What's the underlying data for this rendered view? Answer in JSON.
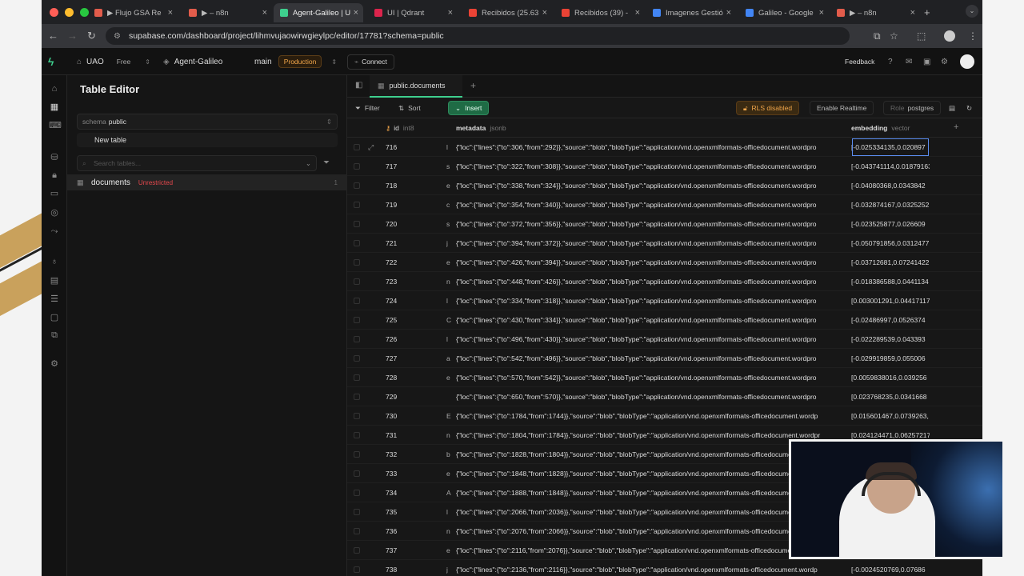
{
  "browser": {
    "tabs": [
      {
        "label": "▶ Flujo GSA Re",
        "color": "#e25c4b"
      },
      {
        "label": "▶ – n8n",
        "color": "#e25c4b"
      },
      {
        "label": "Agent-Galileo | U",
        "color": "#3ecf8e"
      },
      {
        "label": "UI | Qdrant",
        "color": "#dc244c"
      },
      {
        "label": "Recibidos (25.63",
        "color": "#ea4335"
      },
      {
        "label": "Recibidos (39) -",
        "color": "#ea4335"
      },
      {
        "label": "Imagenes Gestió",
        "color": "#4285f4"
      },
      {
        "label": "Galileo - Google",
        "color": "#4285f4"
      },
      {
        "label": "▶ – n8n",
        "color": "#e25c4b"
      }
    ],
    "url": "supabase.com/dashboard/project/lihmvujaowirwgieylpc/editor/17781?schema=public"
  },
  "topnav": {
    "org": "UAO",
    "plan": "Free",
    "project": "Agent-Galileo",
    "branch": "main",
    "env": "Production",
    "connect": "Connect",
    "feedback": "Feedback"
  },
  "sidebar": {
    "title": "Table Editor",
    "schema_label": "schema",
    "schema_value": "public",
    "new_table": "New table",
    "search_placeholder": "Search tables...",
    "table_name": "documents",
    "table_badge": "Unrestricted",
    "table_count": "1"
  },
  "editor": {
    "tab_label": "public.documents",
    "filter": "Filter",
    "sort": "Sort",
    "insert": "Insert",
    "rls": "RLS disabled",
    "realtime": "Enable Realtime",
    "role_label": "Role",
    "role_value": "postgres",
    "columns": [
      {
        "name": "id",
        "type": "int8"
      },
      {
        "name": "metadata",
        "type": "jsonb"
      },
      {
        "name": "embedding",
        "type": "vector"
      }
    ],
    "rows": [
      {
        "id": "716",
        "pre": "l",
        "meta": "{\"loc\":{\"lines\":{\"to\":306,\"from\":292}},\"source\":\"blob\",\"blobType\":\"application/vnd.openxmlformats-officedocument.wordpro",
        "emb": "[-0.025334135,0.020897"
      },
      {
        "id": "717",
        "pre": "s",
        "meta": "{\"loc\":{\"lines\":{\"to\":322,\"from\":308}},\"source\":\"blob\",\"blobType\":\"application/vnd.openxmlformats-officedocument.wordpro",
        "emb": "[-0.043741114,0.01879163"
      },
      {
        "id": "718",
        "pre": "e",
        "meta": "{\"loc\":{\"lines\":{\"to\":338,\"from\":324}},\"source\":\"blob\",\"blobType\":\"application/vnd.openxmlformats-officedocument.wordpro",
        "emb": "[-0.04080368,0.0343842"
      },
      {
        "id": "719",
        "pre": "c",
        "meta": "{\"loc\":{\"lines\":{\"to\":354,\"from\":340}},\"source\":\"blob\",\"blobType\":\"application/vnd.openxmlformats-officedocument.wordpro",
        "emb": "[-0.032874167,0.0325252"
      },
      {
        "id": "720",
        "pre": "s",
        "meta": "{\"loc\":{\"lines\":{\"to\":372,\"from\":356}},\"source\":\"blob\",\"blobType\":\"application/vnd.openxmlformats-officedocument.wordpro",
        "emb": "[-0.023525877,0.026609"
      },
      {
        "id": "721",
        "pre": "j",
        "meta": "{\"loc\":{\"lines\":{\"to\":394,\"from\":372}},\"source\":\"blob\",\"blobType\":\"application/vnd.openxmlformats-officedocument.wordpro",
        "emb": "[-0.050791856,0.0312477"
      },
      {
        "id": "722",
        "pre": "e",
        "meta": "{\"loc\":{\"lines\":{\"to\":426,\"from\":394}},\"source\":\"blob\",\"blobType\":\"application/vnd.openxmlformats-officedocument.wordpro",
        "emb": "[-0.03712681,0.07241422"
      },
      {
        "id": "723",
        "pre": "n",
        "meta": "{\"loc\":{\"lines\":{\"to\":448,\"from\":426}},\"source\":\"blob\",\"blobType\":\"application/vnd.openxmlformats-officedocument.wordpro",
        "emb": "[-0.018386588,0.0441134"
      },
      {
        "id": "724",
        "pre": "l",
        "meta": "{\"loc\":{\"lines\":{\"to\":334,\"from\":318}},\"source\":\"blob\",\"blobType\":\"application/vnd.openxmlformats-officedocument.wordpro",
        "emb": "[0.003001291,0.04417117"
      },
      {
        "id": "725",
        "pre": "C",
        "meta": "{\"loc\":{\"lines\":{\"to\":430,\"from\":334}},\"source\":\"blob\",\"blobType\":\"application/vnd.openxmlformats-officedocument.wordpro",
        "emb": "[-0.02486997,0.0526374"
      },
      {
        "id": "726",
        "pre": "l",
        "meta": "{\"loc\":{\"lines\":{\"to\":496,\"from\":430}},\"source\":\"blob\",\"blobType\":\"application/vnd.openxmlformats-officedocument.wordpro",
        "emb": "[-0.022289539,0.043393"
      },
      {
        "id": "727",
        "pre": "a",
        "meta": "{\"loc\":{\"lines\":{\"to\":542,\"from\":496}},\"source\":\"blob\",\"blobType\":\"application/vnd.openxmlformats-officedocument.wordpro",
        "emb": "[-0.029919859,0.055006"
      },
      {
        "id": "728",
        "pre": "e",
        "meta": "{\"loc\":{\"lines\":{\"to\":570,\"from\":542}},\"source\":\"blob\",\"blobType\":\"application/vnd.openxmlformats-officedocument.wordpro",
        "emb": "[0.0059838016,0.039256"
      },
      {
        "id": "729",
        "pre": "",
        "meta": "{\"loc\":{\"lines\":{\"to\":650,\"from\":570}},\"source\":\"blob\",\"blobType\":\"application/vnd.openxmlformats-officedocument.wordpro",
        "emb": "[0.023768235,0.0341668"
      },
      {
        "id": "730",
        "pre": "E",
        "meta": "{\"loc\":{\"lines\":{\"to\":1784,\"from\":1744}},\"source\":\"blob\",\"blobType\":\"application/vnd.openxmlformats-officedocument.wordp",
        "emb": "[0.015601467,0.0739263,"
      },
      {
        "id": "731",
        "pre": "n",
        "meta": "{\"loc\":{\"lines\":{\"to\":1804,\"from\":1784}},\"source\":\"blob\",\"blobType\":\"application/vnd.openxmlformats-officedocument.wordpr",
        "emb": "[0.024124471,0.06257217"
      },
      {
        "id": "732",
        "pre": "b",
        "meta": "{\"loc\":{\"lines\":{\"to\":1828,\"from\":1804}},\"source\":\"blob\",\"blobType\":\"application/vnd.openxmlformats-officedocument.wordpr",
        "emb": ""
      },
      {
        "id": "733",
        "pre": "e",
        "meta": "{\"loc\":{\"lines\":{\"to\":1848,\"from\":1828}},\"source\":\"blob\",\"blobType\":\"application/vnd.openxmlformats-officedocument.wordpr",
        "emb": ""
      },
      {
        "id": "734",
        "pre": "A",
        "meta": "{\"loc\":{\"lines\":{\"to\":1888,\"from\":1848}},\"source\":\"blob\",\"blobType\":\"application/vnd.openxmlformats-officedocument.wordpr",
        "emb": ""
      },
      {
        "id": "735",
        "pre": "l",
        "meta": "{\"loc\":{\"lines\":{\"to\":2066,\"from\":2036}},\"source\":\"blob\",\"blobType\":\"application/vnd.openxmlformats-officedocument.wordp",
        "emb": ""
      },
      {
        "id": "736",
        "pre": "n",
        "meta": "{\"loc\":{\"lines\":{\"to\":2076,\"from\":2066}},\"source\":\"blob\",\"blobType\":\"application/vnd.openxmlformats-officedocument.wordp",
        "emb": ""
      },
      {
        "id": "737",
        "pre": "e",
        "meta": "{\"loc\":{\"lines\":{\"to\":2116,\"from\":2076}},\"source\":\"blob\",\"blobType\":\"application/vnd.openxmlformats-officedocument.wordp",
        "emb": ""
      },
      {
        "id": "738",
        "pre": "j",
        "meta": "{\"loc\":{\"lines\":{\"to\":2136,\"from\":2116}},\"source\":\"blob\",\"blobType\":\"application/vnd.openxmlformats-officedocument.wordp",
        "emb": "[-0.0024520769,0.07686"
      }
    ]
  },
  "colors": {
    "accent": "#3ecf8e",
    "warning": "#f0a54a",
    "danger": "#e5484d"
  }
}
